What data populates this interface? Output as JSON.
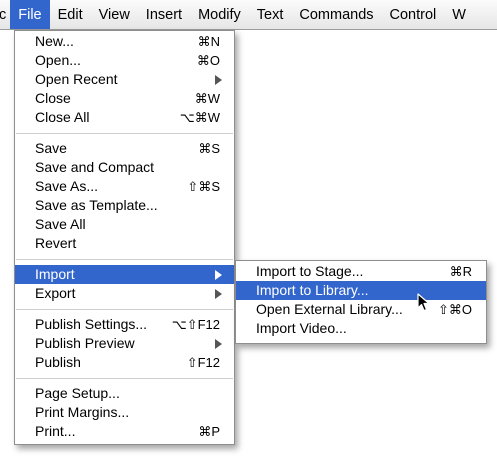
{
  "menubar": {
    "items": [
      {
        "label": "c",
        "active": false
      },
      {
        "label": "File",
        "active": true
      },
      {
        "label": "Edit",
        "active": false
      },
      {
        "label": "View",
        "active": false
      },
      {
        "label": "Insert",
        "active": false
      },
      {
        "label": "Modify",
        "active": false
      },
      {
        "label": "Text",
        "active": false
      },
      {
        "label": "Commands",
        "active": false
      },
      {
        "label": "Control",
        "active": false
      },
      {
        "label": "W",
        "active": false
      }
    ]
  },
  "file_menu": {
    "groups": [
      [
        {
          "label": "New...",
          "shortcut": "⌘N"
        },
        {
          "label": "Open...",
          "shortcut": "⌘O"
        },
        {
          "label": "Open Recent",
          "shortcut": "",
          "submenu": true
        },
        {
          "label": "Close",
          "shortcut": "⌘W"
        },
        {
          "label": "Close All",
          "shortcut": "⌥⌘W"
        }
      ],
      [
        {
          "label": "Save",
          "shortcut": "⌘S"
        },
        {
          "label": "Save and Compact",
          "shortcut": ""
        },
        {
          "label": "Save As...",
          "shortcut": "⇧⌘S"
        },
        {
          "label": "Save as Template...",
          "shortcut": ""
        },
        {
          "label": "Save All",
          "shortcut": ""
        },
        {
          "label": "Revert",
          "shortcut": ""
        }
      ],
      [
        {
          "label": "Import",
          "shortcut": "",
          "submenu": true,
          "highlighted": true
        },
        {
          "label": "Export",
          "shortcut": "",
          "submenu": true
        }
      ],
      [
        {
          "label": "Publish Settings...",
          "shortcut": "⌥⇧F12"
        },
        {
          "label": "Publish Preview",
          "shortcut": "",
          "submenu": true
        },
        {
          "label": "Publish",
          "shortcut": "⇧F12"
        }
      ],
      [
        {
          "label": "Page Setup...",
          "shortcut": ""
        },
        {
          "label": "Print Margins...",
          "shortcut": ""
        },
        {
          "label": "Print...",
          "shortcut": "⌘P"
        }
      ]
    ]
  },
  "import_submenu": {
    "items": [
      {
        "label": "Import to Stage...",
        "shortcut": "⌘R",
        "highlighted": false
      },
      {
        "label": "Import to Library...",
        "shortcut": "",
        "highlighted": true
      },
      {
        "label": "Open External Library...",
        "shortcut": "⇧⌘O",
        "highlighted": false
      },
      {
        "label": "Import Video...",
        "shortcut": "",
        "highlighted": false
      }
    ]
  },
  "colors": {
    "highlight": "#3366cc",
    "menu_background": "#ffffff",
    "separator": "#cfcfcf"
  }
}
